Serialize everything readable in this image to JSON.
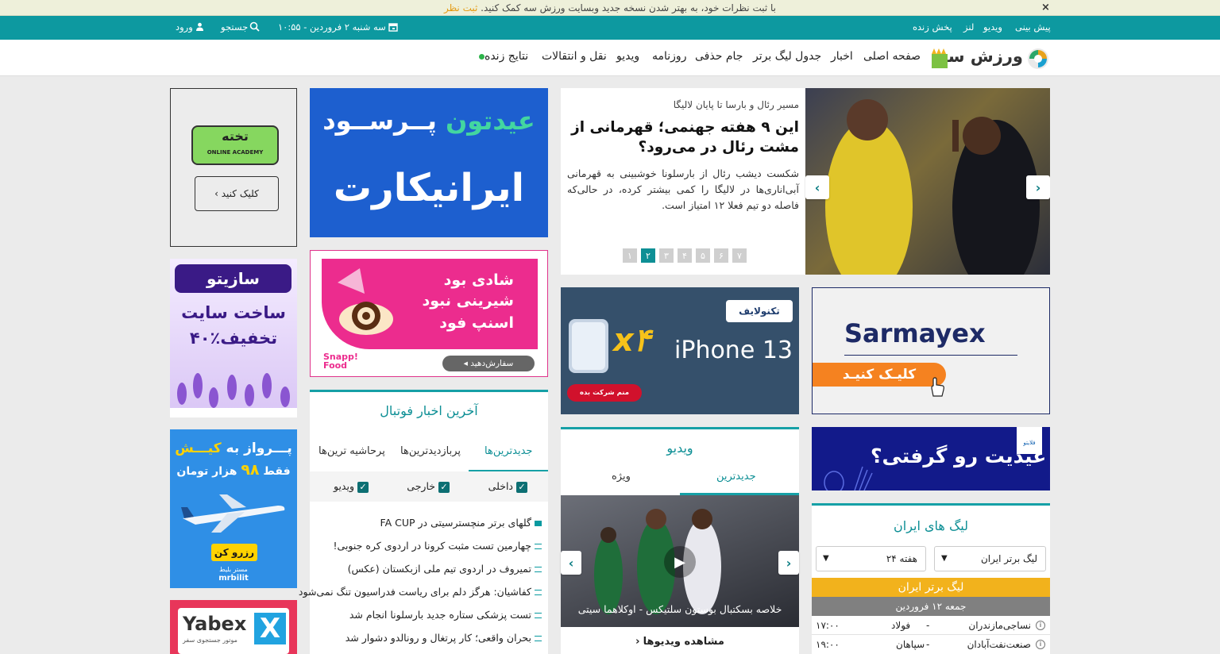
{
  "notice": {
    "text": "با ثبت نظرات خود، به بهتر شدن نسخه جدید وبسایت ورزش سه کمک کنید.",
    "link": "ثبت نظر",
    "close": "×"
  },
  "topbar": {
    "links": [
      "پیش بینی",
      "ویدیو",
      "لنز",
      "پخش زنده"
    ],
    "date": "سه شنبه ۲ فروردین - ۱۰:۵۵",
    "search": "جستجو",
    "login": "ورود"
  },
  "brand": {
    "name": "ورزش سه"
  },
  "nav": {
    "items": [
      "صفحه اصلی",
      "اخبار",
      "جدول لیگ برتر",
      "جام حذفی",
      "روزنامه",
      "ویدیو",
      "نقل و انتقالات",
      "نتایج زنده"
    ]
  },
  "hero": {
    "kicker": "مسیر رئال و بارسا تا پایان لالیگا",
    "title": "این ۹ هفته جهنمی؛ قهرمانی از مشت رئال در می‌رود؟",
    "summary": "شکست دیشب رئال از بارسلونا خوشبینی به قهرمانی آبی‌اناری‌ها در لالیگا را کمی بیشتر کرده، در حالی‌که فاصله دو تیم فعلا ۱۲ امتیاز است.",
    "pages": [
      "۷",
      "۶",
      "۵",
      "۴",
      "۳",
      "۲",
      "۱"
    ],
    "active_page": "۲"
  },
  "ads": {
    "academy": {
      "logo_line1": "تخته",
      "logo_line2": "ONLINE ACADEMY",
      "button": "کلیک کنید"
    },
    "saziteh": {
      "brand": "سازیتو",
      "line1": "ساخت سایت",
      "line2": "۴۰٪تخفیف"
    },
    "flight": {
      "line1": "پـــرواز به",
      "dest": "کیـــش",
      "line2": "فقط",
      "price": "۹۸",
      "line3": "هزار تومان",
      "button": "رزرو کن",
      "brand": "mrbilit",
      "brand_fa": "مستر بلیط"
    },
    "yabex": {
      "brand": "Yabex",
      "tag": "موتور جستجوی سفر"
    },
    "irankart": {
      "line1": "عیدتون",
      "line1b": "پــرســود",
      "line2": "ایرانیکارت"
    },
    "snapp": {
      "l1": "شادی بود",
      "l2": "شیرینی نبود",
      "l3": "اسنپ فود",
      "brand": "Snapp! Food",
      "cta": "سفارش‌دهید"
    },
    "techno": {
      "brand": "تکنولایف",
      "model": "iPhone 13",
      "mult": "x۴",
      "cta": "منم شرکت بده"
    },
    "sarmayex": {
      "brand": "Sarmayex",
      "cta": "کلیـک کنیـد"
    },
    "eid": {
      "text": "عیدیت رو گرفتی؟",
      "brand": "فلایتو"
    }
  },
  "latest": {
    "title": "آخرین اخبار فوتبال",
    "tabs": [
      "جدیدترین‌ها",
      "پربازدیدترین‌ها",
      "پرحاشیه ترین‌ها"
    ],
    "filters": [
      "داخلی",
      "خارجی",
      "ویدیو"
    ],
    "items": [
      "گلهای برتر منچسترسیتی در FA CUP",
      "چهارمین تست مثبت کرونا در اردوی کره جنوبی!",
      "تمیروف در اردوی تیم ملی ازبکستان (عکس)",
      "کفاشیان: هرگز دلم برای ریاست فدراسیون تنگ نمی‌شود",
      "تست پزشکی ستاره جدید بارسلونا انجام شد",
      "بحران واقعی؛ کار پرتغال و رونالدو دشوار شد"
    ]
  },
  "video": {
    "title": "ویدیو",
    "tabs": [
      "جدیدترین",
      "ویژه"
    ],
    "caption": "خلاصه بسکتبال بوستون سلتیکس - اوکلاهما سیتی",
    "more": "مشاهده ویدیوها"
  },
  "leagues": {
    "title": "لیگ های ایران",
    "league_select": "لیگ برتر ایران",
    "week_select": "هفته ۲۴",
    "league_band": "لیگ برتر ایران",
    "date_band": "جمعه ۱۲ فروردین",
    "matches": [
      {
        "home": "نساجی‌مازندران",
        "away": "فولاد",
        "time": "۱۷:۰۰"
      },
      {
        "home": "صنعت‌نفت‌آبادان",
        "away": "سپاهان",
        "time": "۱۹:۰۰"
      }
    ]
  },
  "colors": {
    "teal": "#0d99a0",
    "nav_bg": "#ffffff",
    "accent": "#e49a12"
  }
}
